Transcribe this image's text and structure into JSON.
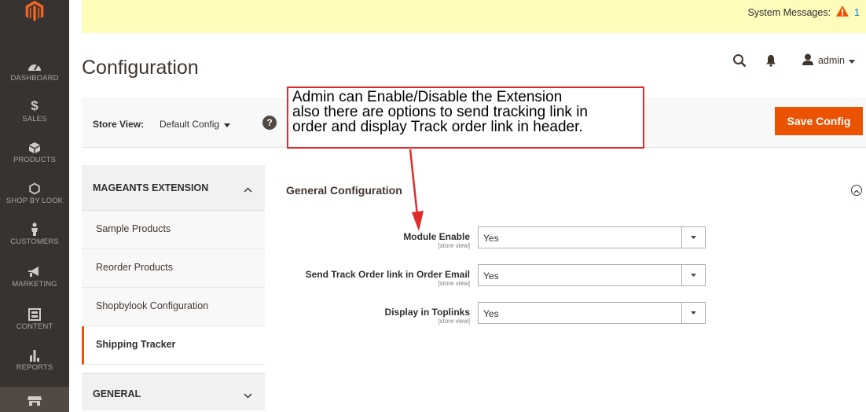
{
  "sidebar": {
    "items": [
      {
        "label": "DASHBOARD",
        "icon": "dashboard-icon"
      },
      {
        "label": "SALES",
        "icon": "dollar-icon"
      },
      {
        "label": "PRODUCTS",
        "icon": "cube-icon"
      },
      {
        "label": "SHOP BY LOOK",
        "icon": "hexagon-icon"
      },
      {
        "label": "CUSTOMERS",
        "icon": "person-icon"
      },
      {
        "label": "MARKETING",
        "icon": "megaphone-icon"
      },
      {
        "label": "CONTENT",
        "icon": "layout-icon"
      },
      {
        "label": "REPORTS",
        "icon": "bar-chart-icon"
      },
      {
        "label": "",
        "icon": "store-icon"
      }
    ]
  },
  "system_messages": {
    "label": "System Messages:",
    "count": "1"
  },
  "page": {
    "title": "Configuration"
  },
  "header": {
    "user": "admin"
  },
  "store_view": {
    "label": "Store View:",
    "value": "Default Config",
    "help": "?"
  },
  "actions": {
    "save": "Save Config"
  },
  "tabs": {
    "section1": "MAGEANTS EXTENSION",
    "links": [
      "Sample Products",
      "Reorder Products",
      "Shopbylook Configuration",
      "Shipping Tracker"
    ],
    "section2": "GENERAL"
  },
  "config": {
    "section_title": "General Configuration",
    "fields": [
      {
        "label": "Module Enable",
        "scope": "[store view]",
        "value": "Yes"
      },
      {
        "label": "Send Track Order link in Order Email",
        "scope": "[store view]",
        "value": "Yes"
      },
      {
        "label": "Display in Toplinks",
        "scope": "[store view]",
        "value": "Yes"
      }
    ]
  },
  "annotation": {
    "lines": [
      "Admin can Enable/Disable the Extension",
      "also there are options to send tracking link in",
      "order and display Track order link in header."
    ]
  },
  "colors": {
    "accent": "#eb5202",
    "sidebar_bg": "#373330",
    "system_bar": "#fffbbb",
    "annotation": "#e02b2b"
  }
}
